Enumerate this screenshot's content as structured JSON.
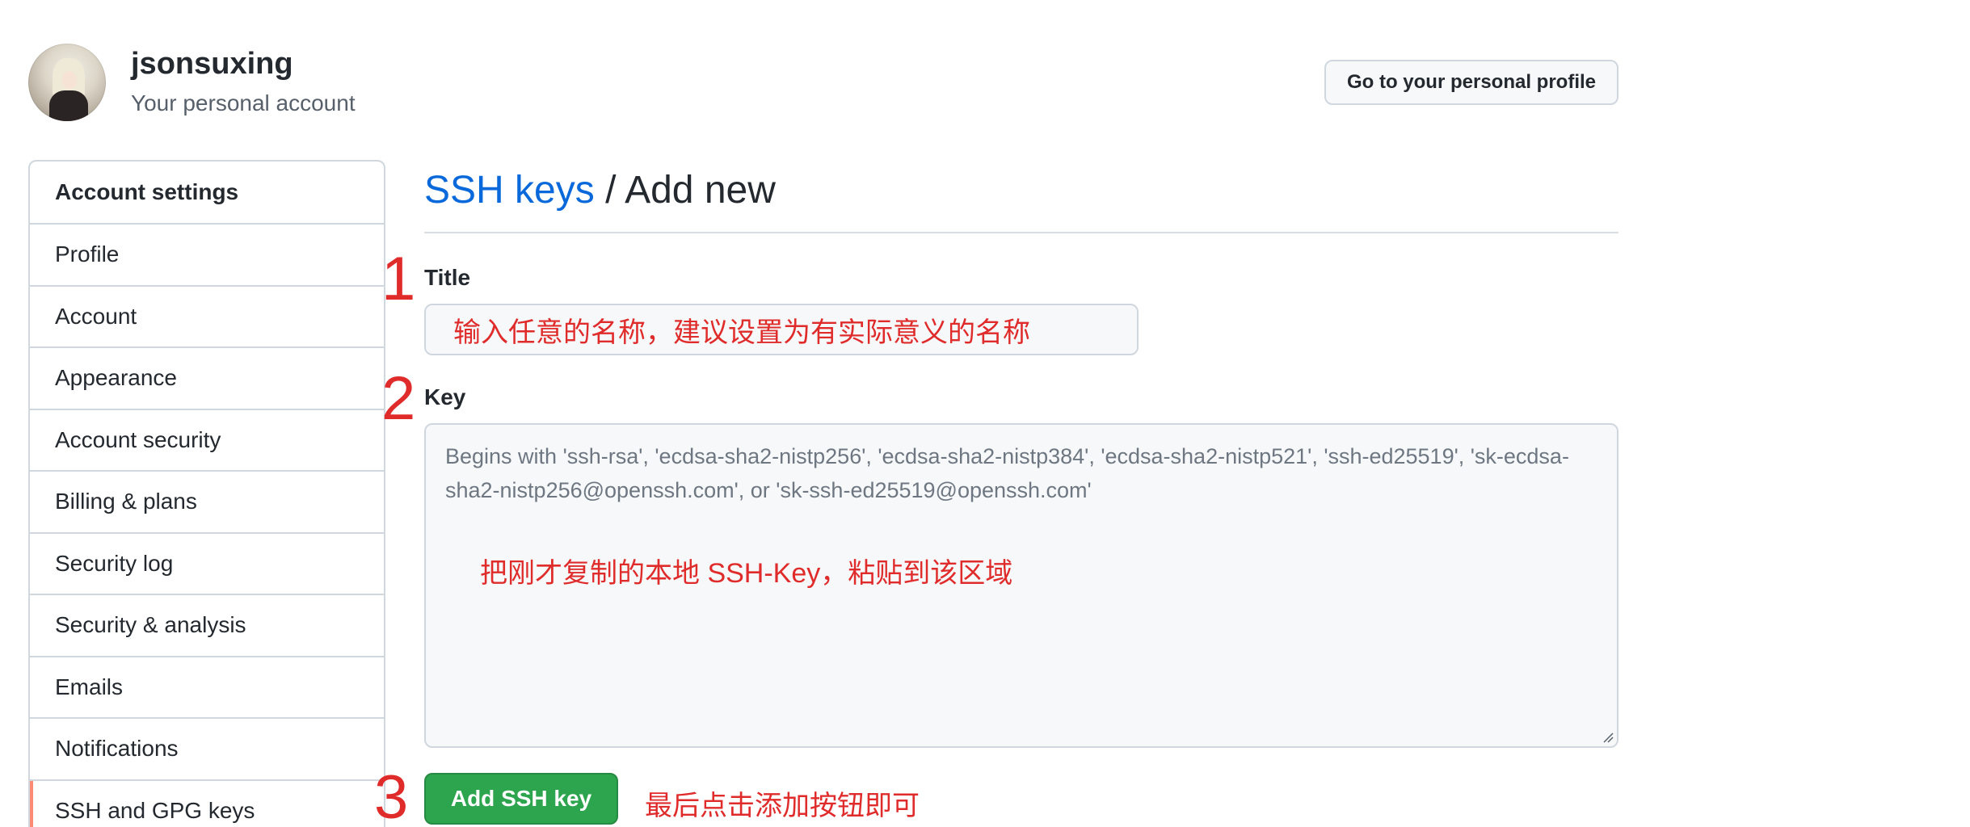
{
  "header": {
    "username": "jsonsuxing",
    "subtitle": "Your personal account",
    "profile_button": "Go to your personal profile"
  },
  "sidebar": {
    "heading": "Account settings",
    "items": [
      {
        "label": "Profile"
      },
      {
        "label": "Account"
      },
      {
        "label": "Appearance"
      },
      {
        "label": "Account security"
      },
      {
        "label": "Billing & plans"
      },
      {
        "label": "Security log"
      },
      {
        "label": "Security & analysis"
      },
      {
        "label": "Emails"
      },
      {
        "label": "Notifications"
      },
      {
        "label": "SSH and GPG keys",
        "active": true
      }
    ]
  },
  "main": {
    "breadcrumb_link": "SSH keys",
    "breadcrumb_current": " / Add new",
    "title_label": "Title",
    "title_value": "输入任意的名称，建议设置为有实际意义的名称",
    "key_label": "Key",
    "key_placeholder": "Begins with 'ssh-rsa', 'ecdsa-sha2-nistp256', 'ecdsa-sha2-nistp384', 'ecdsa-sha2-nistp521', 'ssh-ed25519', 'sk-ecdsa-sha2-nistp256@openssh.com', or 'sk-ssh-ed25519@openssh.com'",
    "key_annotation": "把刚才复制的本地 SSH-Key，粘贴到该区域",
    "submit_label": "Add SSH key",
    "final_note": "最后点击添加按钮即可"
  },
  "annotations": {
    "step1": "1",
    "step2": "2",
    "step3": "3",
    "color": "#e02b2b"
  },
  "colors": {
    "link": "#0969da",
    "primary_button": "#2da44e",
    "active_indicator": "#fd8c73"
  }
}
